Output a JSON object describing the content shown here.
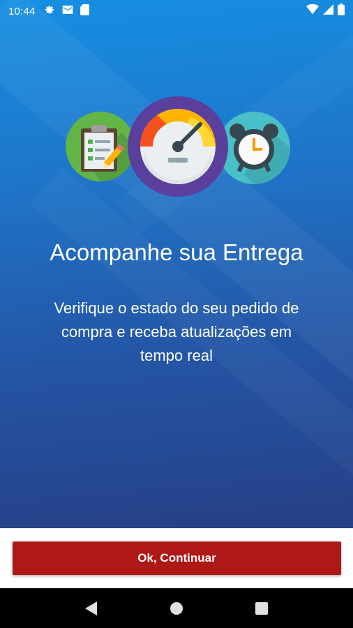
{
  "status_bar": {
    "time": "10:44",
    "icons_left": [
      "settings-icon",
      "mail-icon",
      "sd-card-icon"
    ],
    "icons_right": [
      "wifi-icon",
      "signal-icon",
      "battery-icon"
    ]
  },
  "illustration": {
    "items": [
      "clipboard-icon",
      "speedometer-icon",
      "alarm-clock-icon"
    ],
    "colors": {
      "left": "#62b547",
      "middle": "#5a3f9c",
      "right": "#49bfc8"
    }
  },
  "onboarding": {
    "title": "Acompanhe sua Entrega",
    "subtitle": "Verifique o estado do seu pedido de compra e receba atualizações em tempo real"
  },
  "footer": {
    "continue_label": "Ok, Continuar",
    "button_color": "#ae1816"
  },
  "nav_bar": {
    "buttons": [
      "back-icon",
      "home-icon",
      "recents-icon"
    ]
  }
}
